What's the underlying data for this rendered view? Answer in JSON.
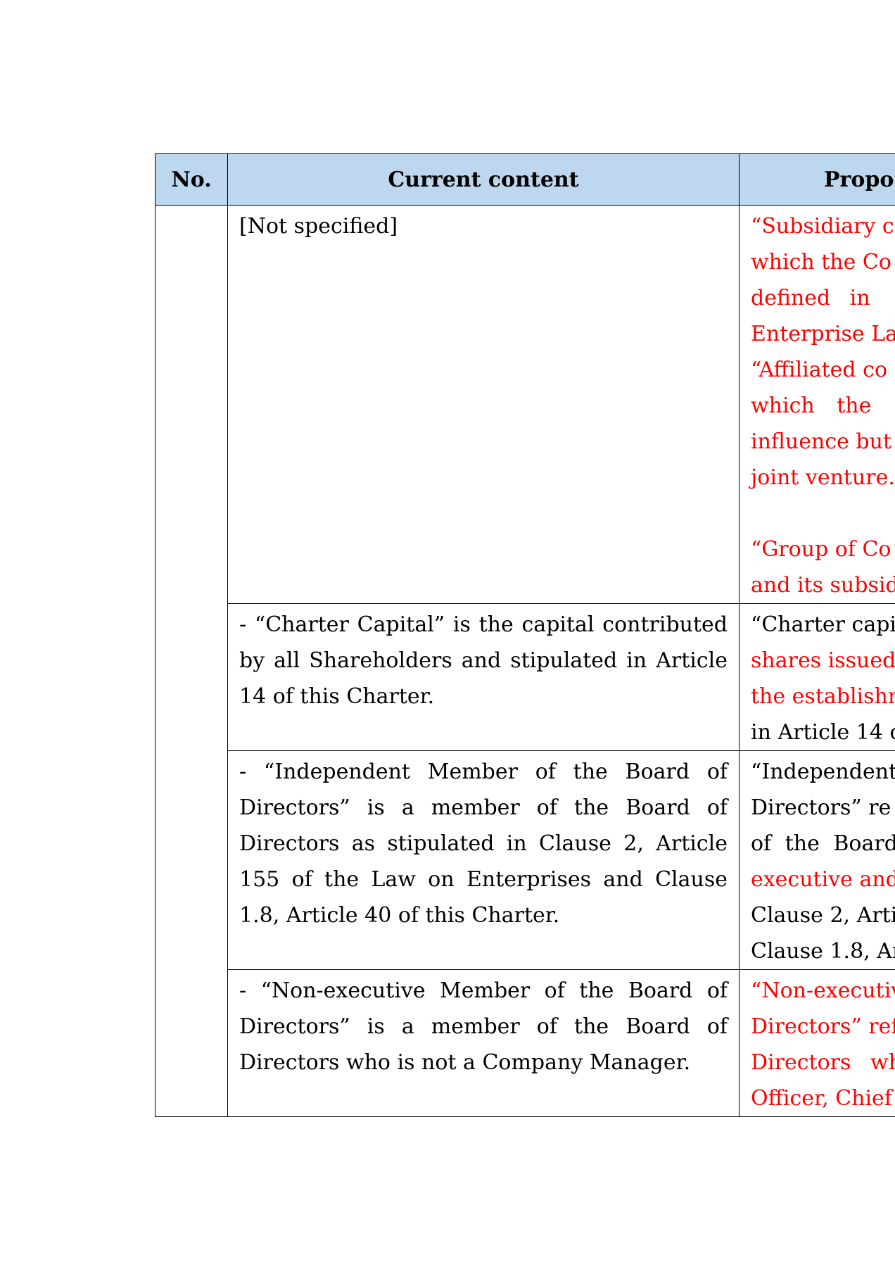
{
  "table": {
    "headers": {
      "no": "No.",
      "current": "Current content",
      "proposed": "Propo"
    },
    "rows": [
      {
        "current": "[Not specified]",
        "proposed_lines": [
          "“Subsidiary c",
          "which the Co",
          "defined in",
          "Enterprise La",
          "“Affiliated co",
          "which the",
          "influence but",
          "joint venture.",
          "",
          "“Group of Co",
          "and its subsid"
        ]
      },
      {
        "current": "- “Charter Capital” is the capital contributed by all Shareholders and stipulated in Article 14 of this Charter.",
        "proposed_lines": [
          "“Charter capi",
          "shares issued",
          "the establishm",
          "in Article 14 o"
        ]
      },
      {
        "current": "- “Independent Member of the Board of Directors” is a member of the Board of Directors as stipulated in Clause 2, Article 155 of the Law on Enterprises and Clause 1.8, Article 40 of this Charter.",
        "proposed_lines": [
          "“Independent",
          "Directors” re",
          "of the Board",
          "executive and",
          "Clause 2, Artic",
          "Clause 1.8, Ar"
        ]
      },
      {
        "current": "- “Non-executive Member of the Board of Directors” is a member of the Board of Directors who is not a Company Manager.",
        "proposed_lines": [
          "“Non-executiv",
          "Directors” ref",
          "Directors wh",
          "Officer, Chief"
        ]
      }
    ]
  },
  "colors": {
    "header_bg": "#bdd7ee",
    "amended_text": "#ff0000",
    "border": "#000000"
  }
}
